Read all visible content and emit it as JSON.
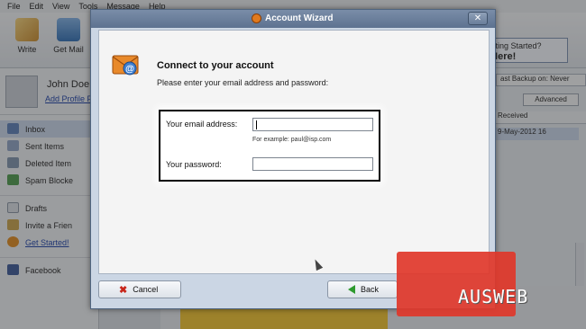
{
  "menu": [
    "File",
    "Edit",
    "View",
    "Tools",
    "Message",
    "Help"
  ],
  "toolbar": {
    "write_label": "Write",
    "getmail_label": "Get Mail"
  },
  "getting_started": {
    "line1": "Getting Started?",
    "line2": "k Here!"
  },
  "profile": {
    "name": "John Doe",
    "link": "Add Profile P"
  },
  "sidebar_items": [
    {
      "label": "Inbox"
    },
    {
      "label": "Sent Items"
    },
    {
      "label": "Deleted Item"
    },
    {
      "label": "Spam Blocke"
    },
    {
      "label": "Drafts"
    },
    {
      "label": "Invite a Frien"
    },
    {
      "label": "Get Started!"
    },
    {
      "label": "Facebook"
    }
  ],
  "right_pane": {
    "backup": "ast Backup on:  Never",
    "advanced": "Advanced",
    "col_received": "Received",
    "date": "9-May-2012 16"
  },
  "dialog": {
    "title": "Account Wizard",
    "close": "✕",
    "heading": "Connect to your account",
    "subheading": "Please enter your email address and password:",
    "email_label": "Your email address:",
    "email_value": "",
    "example": "For example: paul@isp.com",
    "password_label": "Your password:",
    "password_value": "",
    "cancel_label": "Cancel",
    "back_label": "Back"
  },
  "watermark": "AUSWEB",
  "colors": {
    "accent": "#e0372a",
    "titlebar": "#5d7290"
  }
}
